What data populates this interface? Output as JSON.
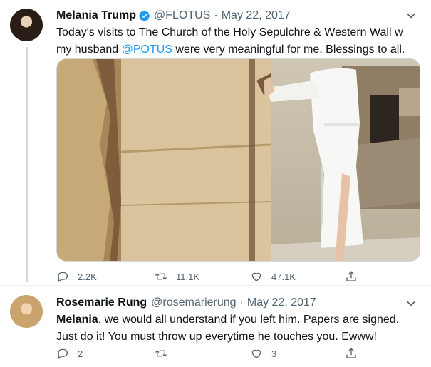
{
  "tweets": [
    {
      "author": "Melania Trump",
      "handle": "@FLOTUS",
      "sep": "·",
      "date": "May 22, 2017",
      "text_before": "Today's visits to The Church of the Holy Sepulchre & Western Wall w my husband ",
      "mention": "@POTUS",
      "text_after": " were very meaningful for me. Blessings to all.",
      "stats": {
        "replies": "2.2K",
        "retweets": "11.1K",
        "likes": "47.1K"
      }
    },
    {
      "author": "Rosemarie Rung",
      "handle": "@rosemarierung",
      "sep": "·",
      "date": "May 22, 2017",
      "bold_name": "Melania",
      "text_after": ", we would all understand if you left him. Papers are signed. Just do it! You must throw up everytime he touches you. Ewww!",
      "stats": {
        "replies": "2",
        "likes": "3"
      }
    }
  ],
  "colors": {
    "accent": "#1d9bf0",
    "muted": "#536471",
    "border": "#cfd9de"
  }
}
